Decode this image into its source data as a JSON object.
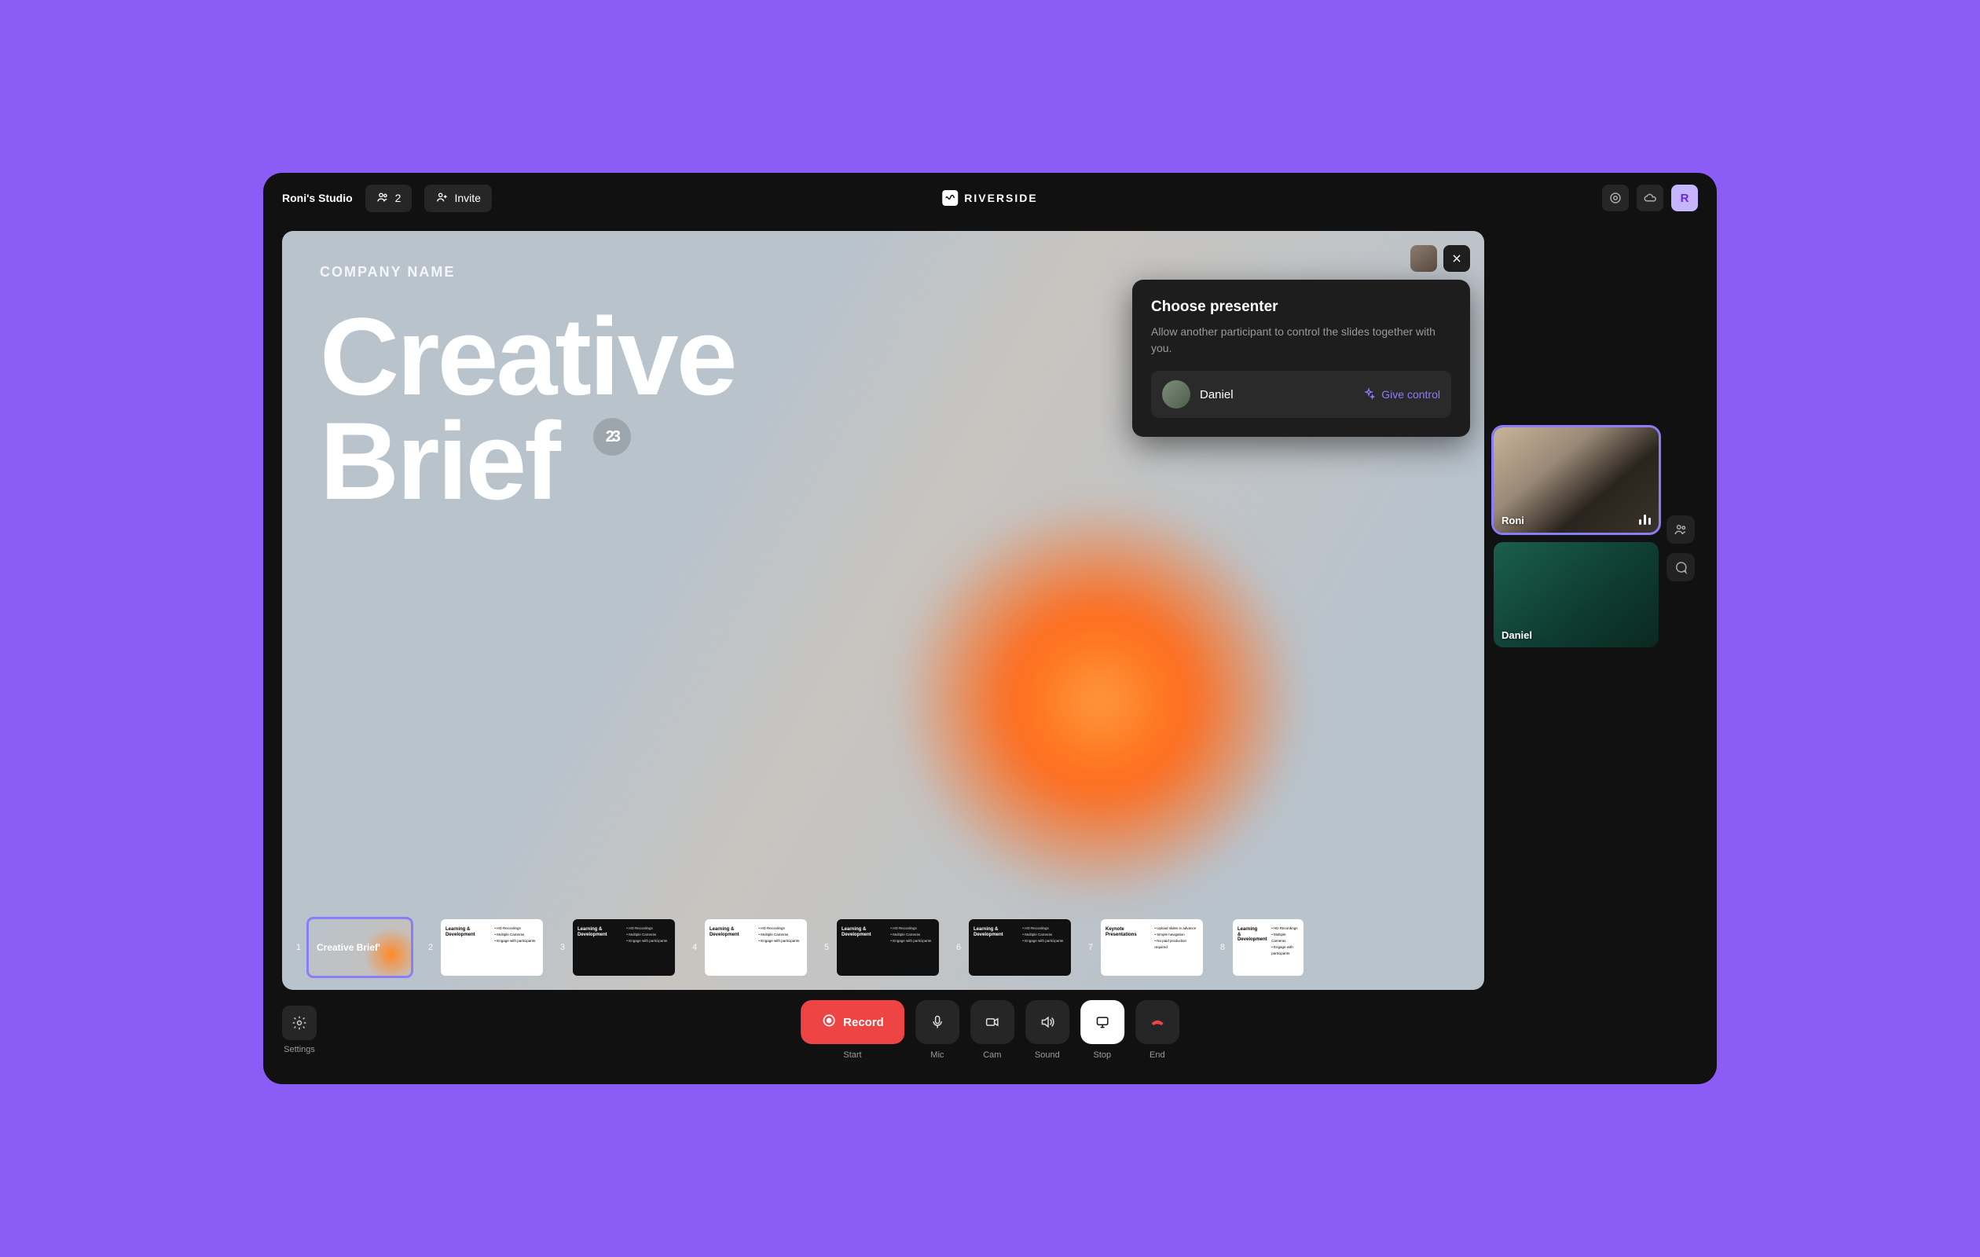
{
  "header": {
    "studio_name": "Roni's Studio",
    "participant_count": "2",
    "invite_label": "Invite",
    "brand_name": "RIVERSIDE",
    "avatar_initial": "R"
  },
  "slide": {
    "company_label": "COMPANY NAME",
    "title_line1": "Creative",
    "title_line2": "Brief",
    "badge": "23"
  },
  "popover": {
    "title": "Choose presenter",
    "description": "Allow another participant to control the slides together with you.",
    "participant_name": "Daniel",
    "action_label": "Give control"
  },
  "participants": {
    "p1_name": "Roni",
    "p2_name": "Daniel"
  },
  "thumbnails": {
    "first_label": "Creative Brief'",
    "learning_title": "Learning & Development",
    "keynote_title": "Keynote Presentations",
    "bullets": {
      "b1": "HD Recordings",
      "b2": "Multiple Cameras",
      "b3": "Engage with participants"
    },
    "keynote_bullets": {
      "b1": "Upload slides in advance",
      "b2": "Simple navigation",
      "b3": "No paid production required"
    },
    "numbers": [
      "1",
      "2",
      "3",
      "4",
      "5",
      "6",
      "7",
      "8"
    ]
  },
  "controls": {
    "settings_label": "Settings",
    "record_label": "Record",
    "start_label": "Start",
    "mic_label": "Mic",
    "cam_label": "Cam",
    "sound_label": "Sound",
    "stop_label": "Stop",
    "end_label": "End"
  }
}
